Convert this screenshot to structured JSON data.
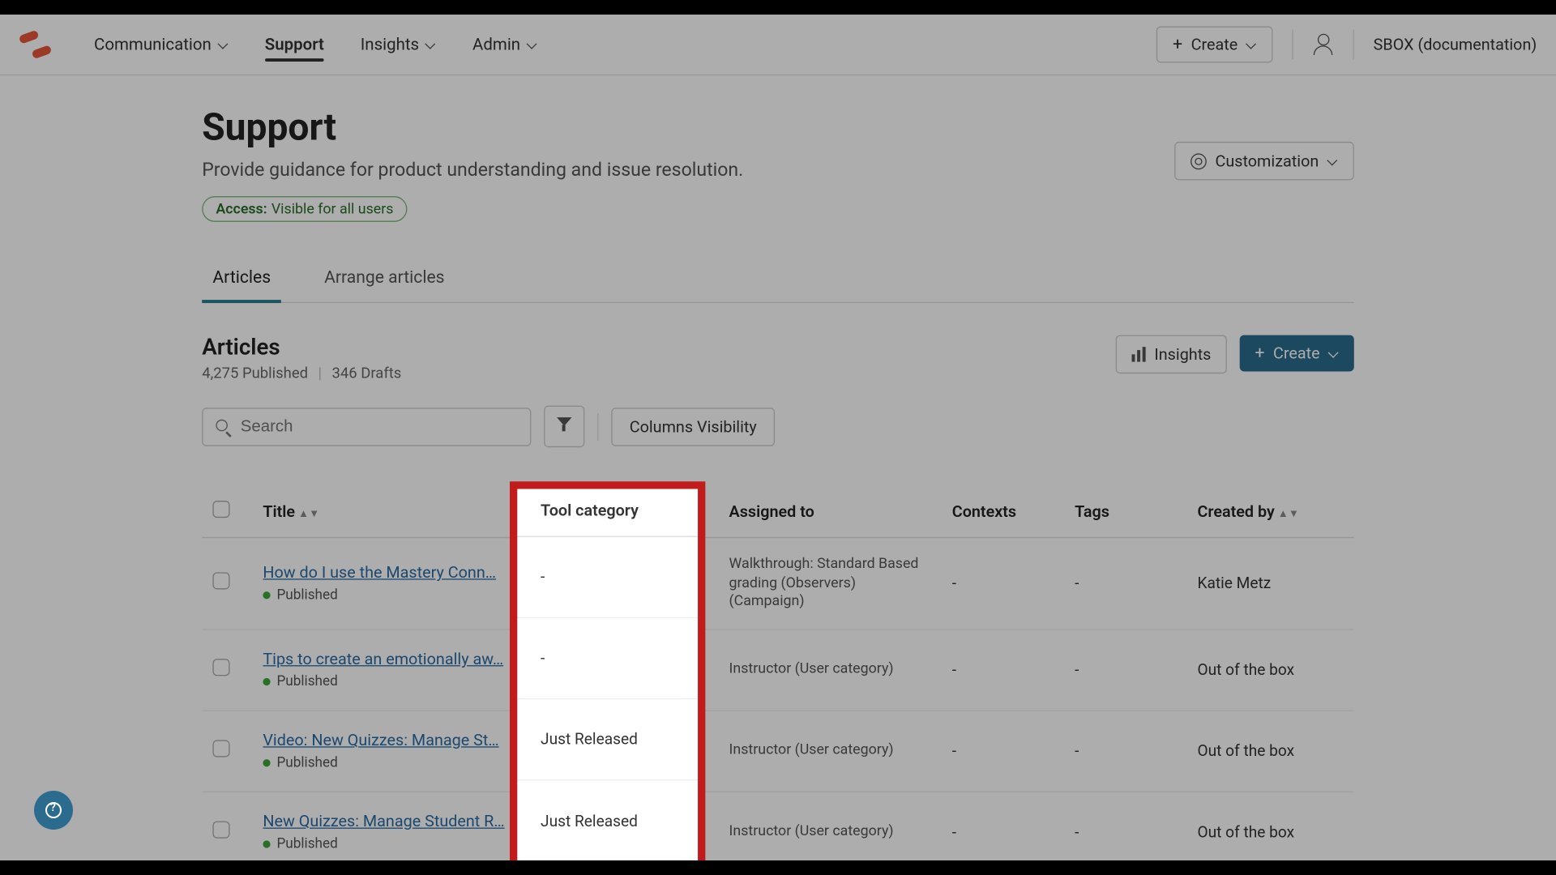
{
  "nav": {
    "items": [
      {
        "label": "Communication",
        "has_chevron": true,
        "active": false
      },
      {
        "label": "Support",
        "has_chevron": false,
        "active": true
      },
      {
        "label": "Insights",
        "has_chevron": true,
        "active": false
      },
      {
        "label": "Admin",
        "has_chevron": true,
        "active": false
      }
    ],
    "create_label": "Create",
    "env_label": "SBOX (documentation)"
  },
  "page": {
    "title": "Support",
    "subtitle": "Provide guidance for product understanding and issue resolution.",
    "customization_label": "Customization",
    "access": {
      "label": "Access:",
      "value": "Visible for all users"
    }
  },
  "tabs": [
    {
      "label": "Articles",
      "active": true
    },
    {
      "label": "Arrange articles",
      "active": false
    }
  ],
  "section": {
    "heading": "Articles",
    "published_count": "4,275 Published",
    "drafts_count": "346 Drafts",
    "insights_label": "Insights",
    "create_label": "Create"
  },
  "toolbar": {
    "search_placeholder": "Search",
    "columns_label": "Columns Visibility"
  },
  "table": {
    "headers": {
      "title": "Title",
      "tool_category": "Tool category",
      "assigned_to": "Assigned to",
      "contexts": "Contexts",
      "tags": "Tags",
      "created_by": "Created by"
    },
    "rows": [
      {
        "title": "How do I use the Mastery Conn…",
        "status": "Published",
        "tool_category": "-",
        "assigned_to": "Walkthrough: Standard Based grading (Observers) (Campaign)",
        "contexts": "-",
        "tags": "-",
        "created_by": "Katie Metz"
      },
      {
        "title": "Tips to create an emotionally aw…",
        "status": "Published",
        "tool_category": "-",
        "assigned_to": "Instructor (User category)",
        "contexts": "-",
        "tags": "-",
        "created_by": "Out of the box"
      },
      {
        "title": "Video: New Quizzes: Manage St…",
        "status": "Published",
        "tool_category": "Just Released",
        "assigned_to": "Instructor (User category)",
        "contexts": "-",
        "tags": "-",
        "created_by": "Out of the box"
      },
      {
        "title": "New Quizzes: Manage Student R…",
        "status": "Published",
        "tool_category": "Just Released",
        "assigned_to": "Instructor (User category)",
        "contexts": "-",
        "tags": "-",
        "created_by": "Out of the box"
      }
    ]
  },
  "highlight": {
    "column": "tool_category"
  }
}
